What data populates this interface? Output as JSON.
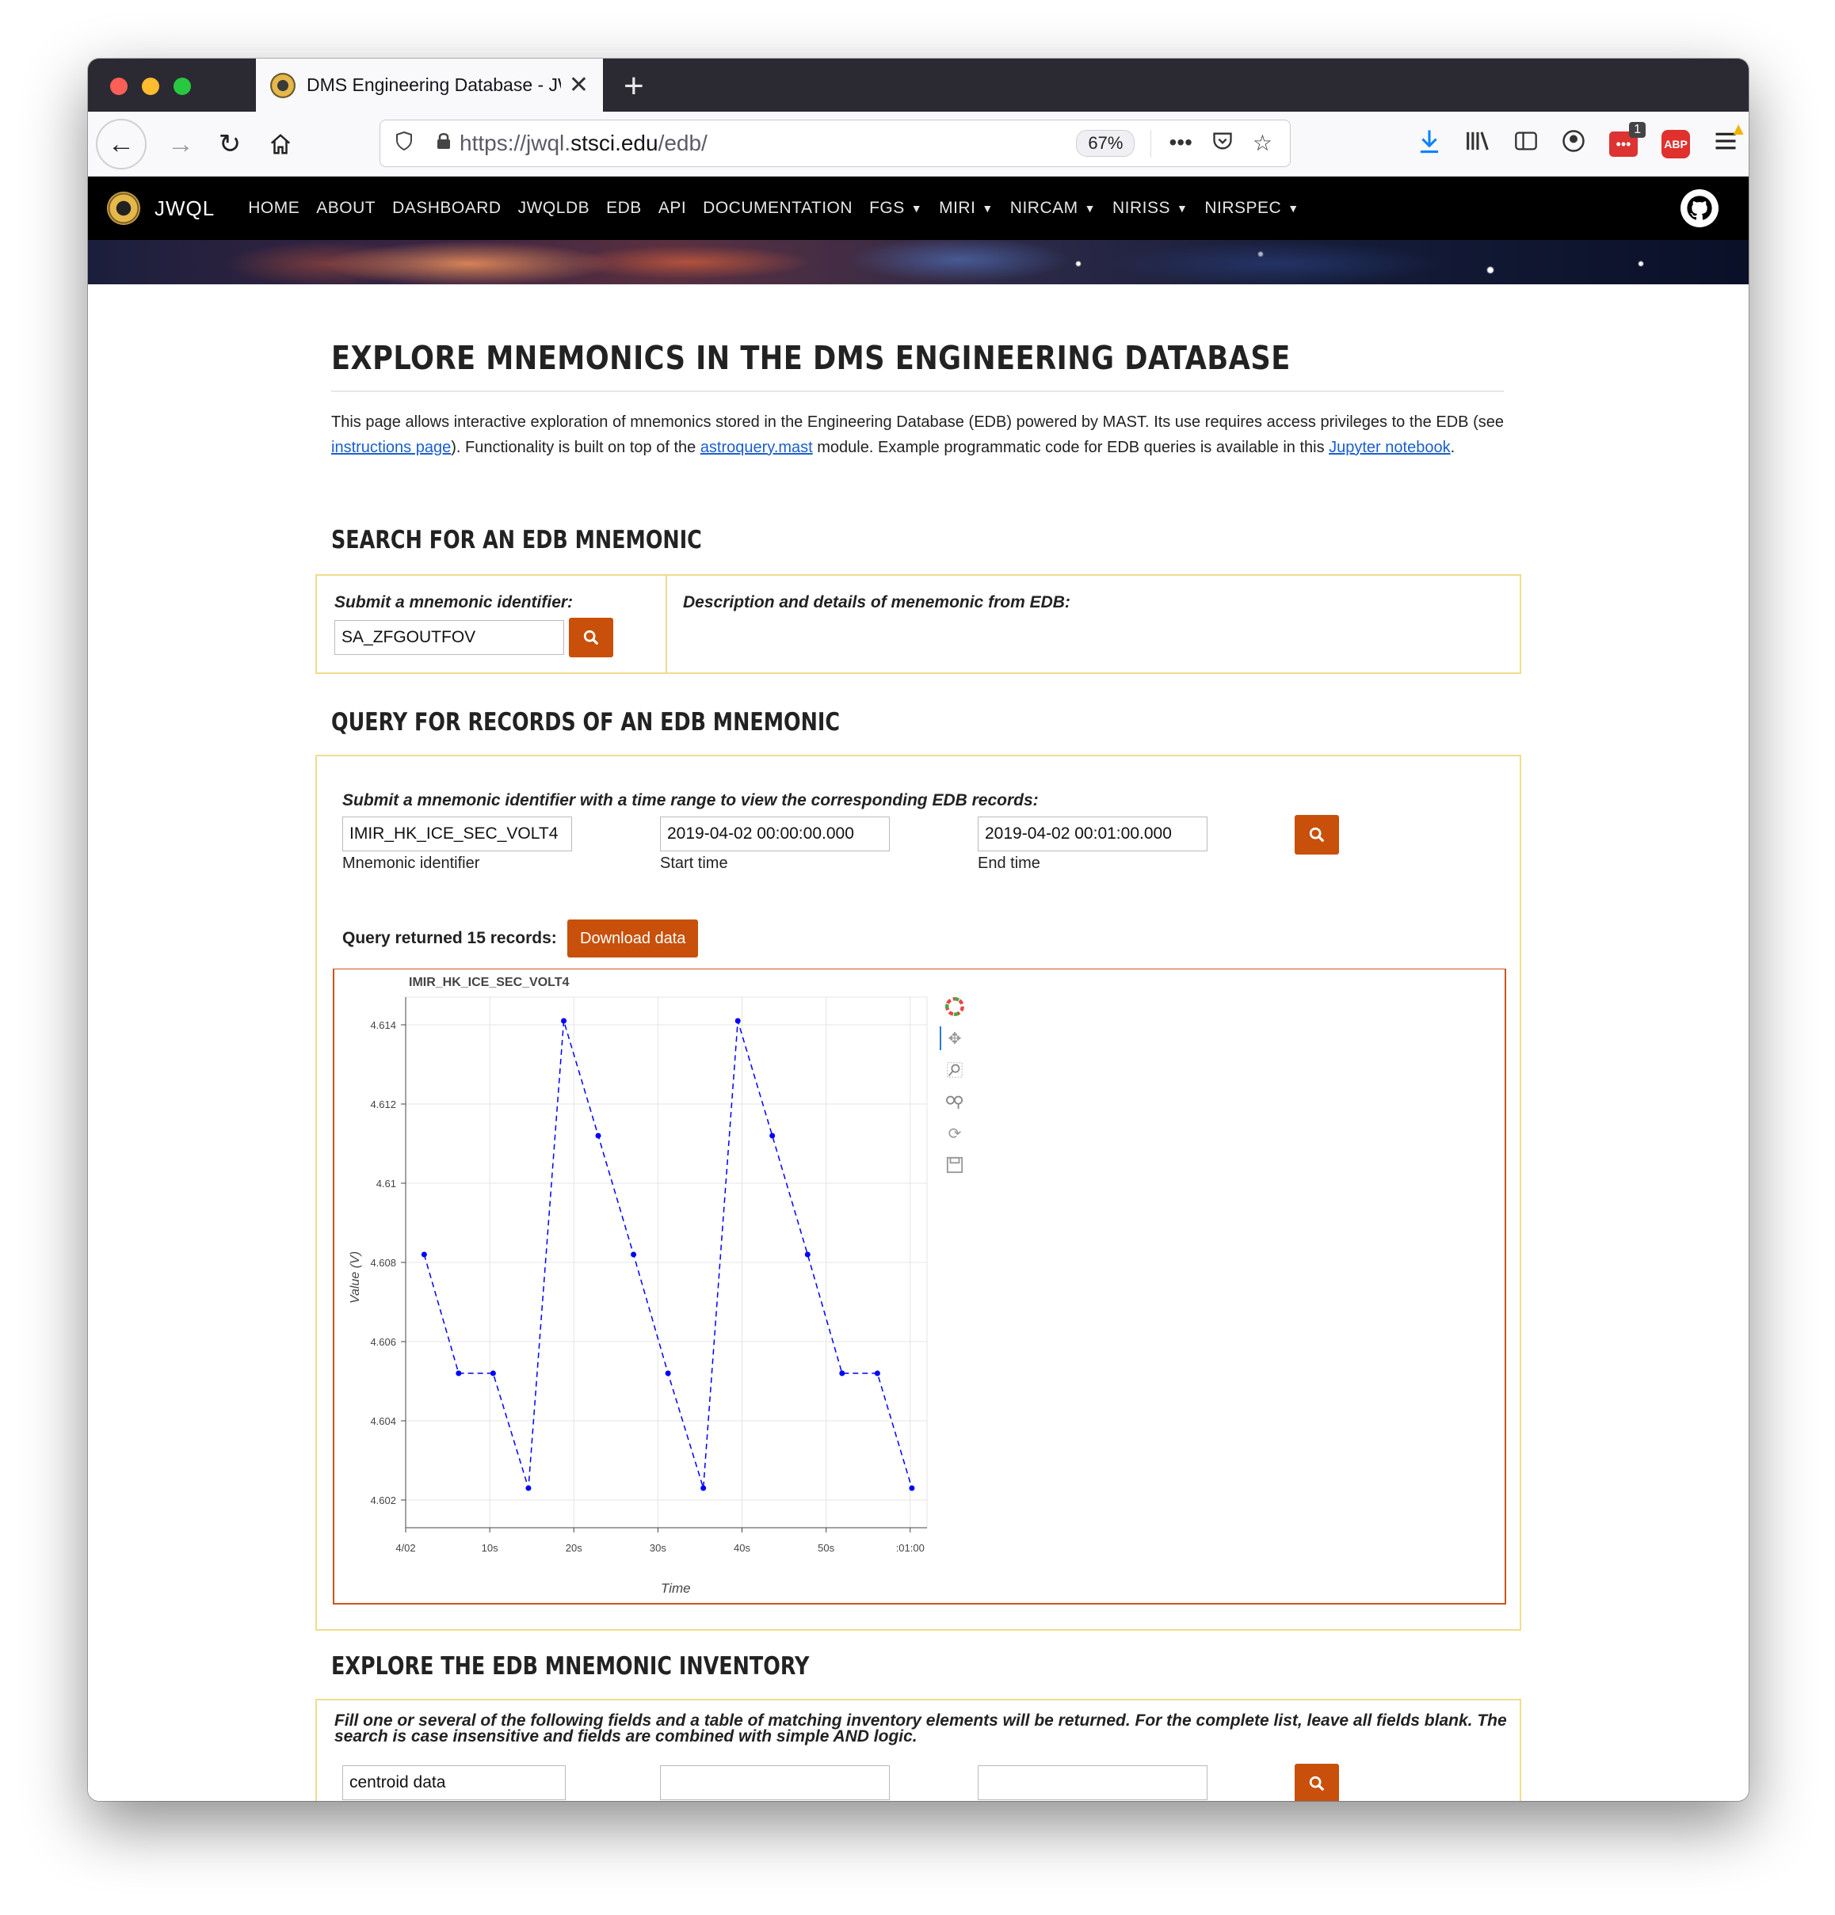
{
  "browser": {
    "tab_title": "DMS Engineering Database - JWQL",
    "url_prefix": "https://jwql.",
    "url_domain": "stsci.edu",
    "url_path": "/edb/",
    "zoom": "67%",
    "extension_badge": "1",
    "abp_label": "ABP"
  },
  "nav": {
    "brand": "JWQL",
    "items": [
      {
        "label": "HOME",
        "dropdown": false
      },
      {
        "label": "ABOUT",
        "dropdown": false
      },
      {
        "label": "DASHBOARD",
        "dropdown": false
      },
      {
        "label": "JWQLDB",
        "dropdown": false
      },
      {
        "label": "EDB",
        "dropdown": false
      },
      {
        "label": "API",
        "dropdown": false
      },
      {
        "label": "DOCUMENTATION",
        "dropdown": false
      },
      {
        "label": "FGS",
        "dropdown": true
      },
      {
        "label": "MIRI",
        "dropdown": true
      },
      {
        "label": "NIRCAM",
        "dropdown": true
      },
      {
        "label": "NIRISS",
        "dropdown": true
      },
      {
        "label": "NIRSPEC",
        "dropdown": true
      }
    ]
  },
  "page": {
    "title": "EXPLORE MNEMONICS IN THE DMS ENGINEERING DATABASE",
    "intro_1": "This page allows interactive exploration of mnemonics stored in the Engineering Database (EDB) powered by MAST. Its use requires access privileges to the EDB (see ",
    "intro_link_1": "instructions page",
    "intro_2": "). Functionality is built on top of the ",
    "intro_link_2": "astroquery.mast",
    "intro_3": " module. Example programmatic code for EDB queries is available in this ",
    "intro_link_3": "Jupyter notebook",
    "intro_4": "."
  },
  "search_section": {
    "heading": "SEARCH FOR AN EDB MNEMONIC",
    "prompt": "Submit a mnemonic identifier:",
    "input_value": "SA_ZFGOUTFOV",
    "description_label": "Description and details of menemonic from EDB:"
  },
  "query_section": {
    "heading": "QUERY FOR RECORDS OF AN EDB MNEMONIC",
    "prompt": "Submit a mnemonic identifier with a time range to view the corresponding EDB records:",
    "mnemonic_value": "IMIR_HK_ICE_SEC_VOLT4",
    "mnemonic_label": "Mnemonic identifier",
    "start_value": "2019-04-02 00:00:00.000",
    "start_label": "Start time",
    "end_value": "2019-04-02 00:01:00.000",
    "end_label": "End time",
    "result_text": "Query returned 15 records:",
    "download_label": "Download data"
  },
  "inventory_section": {
    "heading": "EXPLORE THE EDB MNEMONIC INVENTORY",
    "prompt": "Fill one or several of the following fields and a table of matching inventory elements will be returned. For the complete list, leave all fields blank. The search is case insensitive and fields are combined with simple AND logic.",
    "field1_value": "centroid data",
    "field2_value": "",
    "field3_value": ""
  },
  "colors": {
    "accent": "#c8500a",
    "box_border": "#f0dc8c",
    "series": "#0000ff"
  },
  "chart_data": {
    "type": "line",
    "title": "IMIR_HK_ICE_SEC_VOLT4",
    "xlabel": "Time",
    "ylabel": "Value (V)",
    "x_tick_labels": [
      "4/02",
      "10s",
      "20s",
      "30s",
      "40s",
      "50s",
      ":01:00"
    ],
    "x_ticks_seconds": [
      0,
      10,
      20,
      30,
      40,
      50,
      60
    ],
    "y_ticks": [
      "4.614",
      "4.612",
      "4.61",
      "4.608",
      "4.606",
      "4.604",
      "4.602"
    ],
    "y_tick_values": [
      4.614,
      4.612,
      4.61,
      4.608,
      4.606,
      4.604,
      4.602
    ],
    "xlim_seconds": [
      0,
      62
    ],
    "ylim": [
      4.6013,
      4.6147
    ],
    "line_style": "dashed",
    "series": [
      {
        "x_seconds": [
          2.2,
          6.3,
          10.4,
          14.6,
          18.8,
          22.9,
          27.1,
          31.2,
          35.4,
          39.5,
          43.6,
          47.8,
          51.9,
          56.1,
          60.2
        ],
        "values": [
          4.6082,
          4.6052,
          4.6052,
          4.6023,
          4.6141,
          4.6112,
          4.6082,
          4.6052,
          4.6023,
          4.6141,
          4.6112,
          4.6082,
          4.6052,
          4.6052,
          4.6023
        ]
      }
    ]
  }
}
